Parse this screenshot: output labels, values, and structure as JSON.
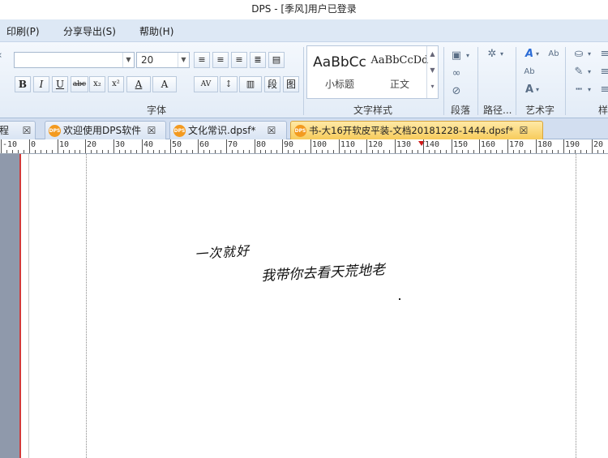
{
  "window": {
    "title": "DPS - [季风]用户已登录"
  },
  "menu": {
    "items": [
      "印刷(P)",
      "分享导出(S)",
      "帮助(H)"
    ]
  },
  "ribbon": {
    "font_name": "",
    "font_size": "20",
    "format_buttons": {
      "bold": "B",
      "italic": "I",
      "underline": "U",
      "strike": "abc",
      "subscript": "x₂",
      "superscript": "x²",
      "font_color": "A",
      "char_shading": "A"
    },
    "groups": {
      "font": "字体",
      "text_style": "文字样式",
      "paragraph": "段落",
      "path": "路径...",
      "art_text": "艺术字",
      "style_partial": "样"
    },
    "styles": [
      {
        "preview": "AaBbCc",
        "name": "小标题"
      },
      {
        "preview": "AaBbCcDd",
        "name": "正文"
      }
    ],
    "para_buttons": {
      "indent": "段",
      "frame": "图"
    }
  },
  "tabs": [
    {
      "label": "程",
      "active": false
    },
    {
      "label": "欢迎使用DPS软件",
      "active": false
    },
    {
      "label": "文化常识.dpsf*",
      "active": false
    },
    {
      "label": "书-大16开软皮平装-文档20181228-1444.dpsf*",
      "active": true
    }
  ],
  "tab_icon_text": "DPS",
  "ruler": {
    "labels": [
      "-10",
      "0",
      "10",
      "20",
      "30",
      "40",
      "50",
      "60",
      "70",
      "80",
      "90",
      "100",
      "110",
      "120",
      "130",
      "140",
      "150",
      "160",
      "170",
      "180",
      "190",
      "20"
    ]
  },
  "canvas": {
    "line1": "一次就好",
    "line2": "我带你去看天荒地老"
  },
  "colors": {
    "accent_tab": "#f7cc5c",
    "menu_bg": "#dde8f5",
    "ribbon_bg": "#e3ecf7",
    "margin_red": "#d23a3a",
    "gutter": "#8f99ab"
  }
}
